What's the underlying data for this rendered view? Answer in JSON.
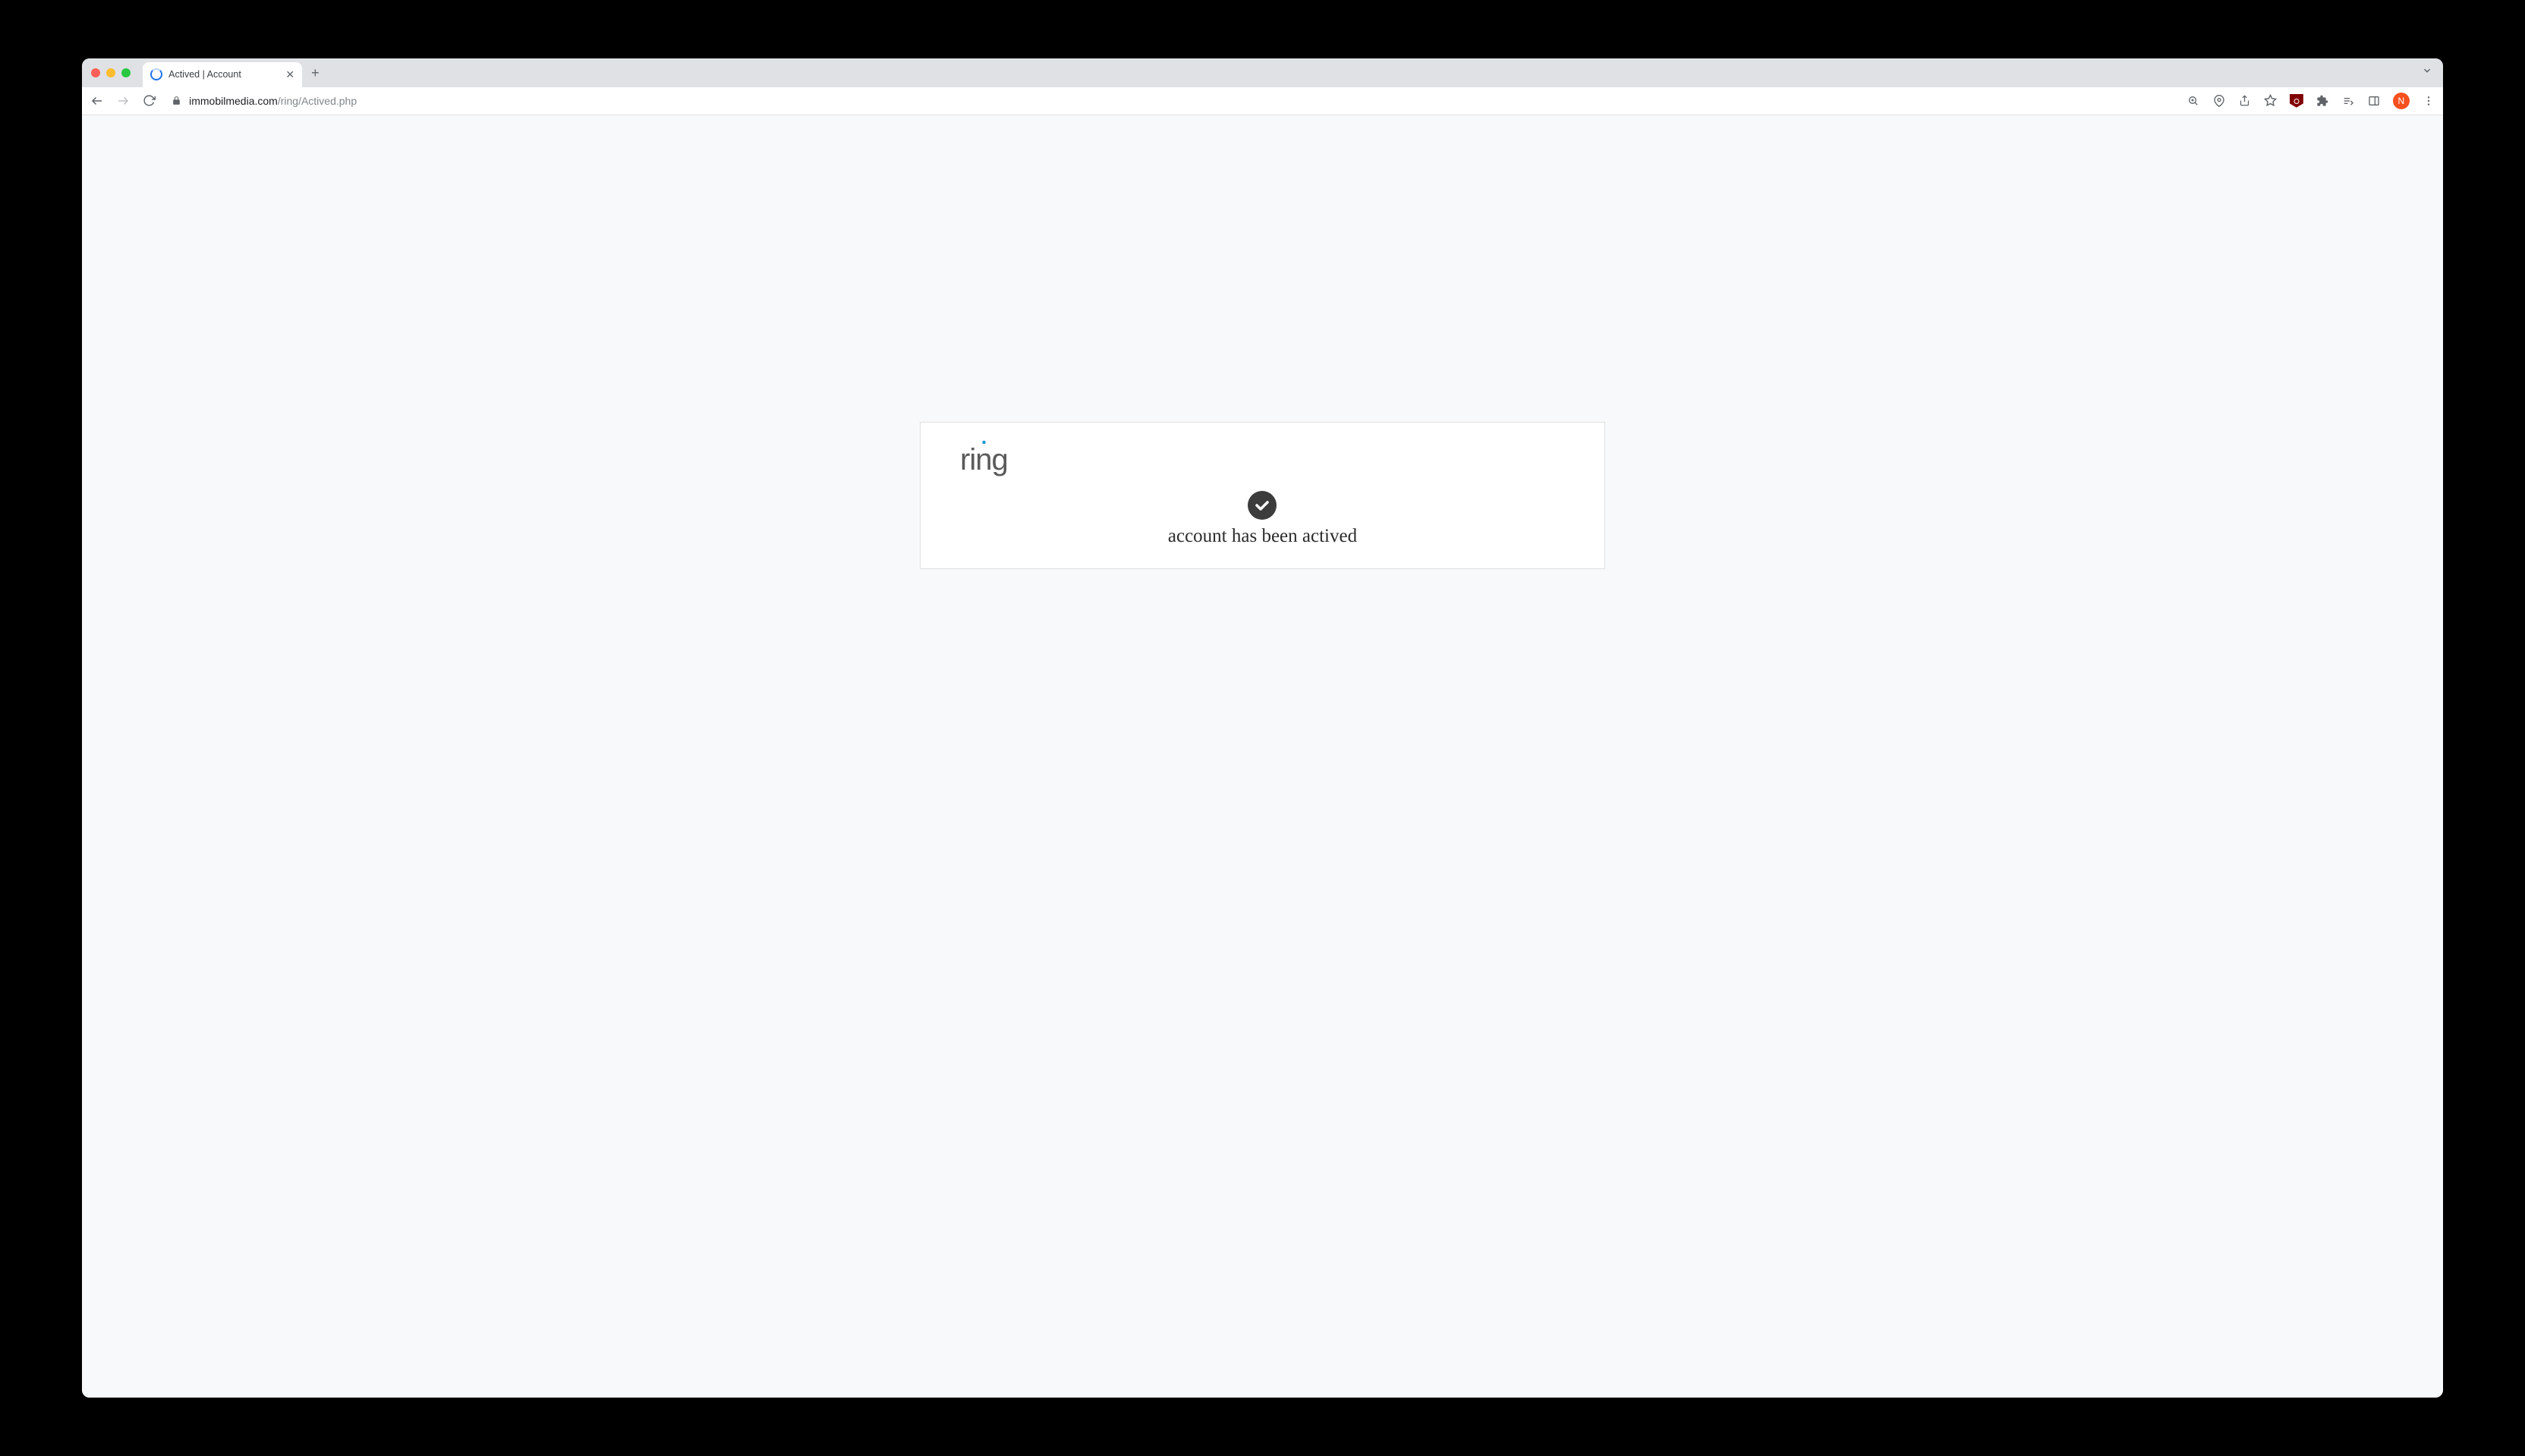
{
  "browser": {
    "tab": {
      "title": "Actived | Account"
    },
    "url": {
      "domain": "immobilmedia.com",
      "path": "/ring/Actived.php"
    },
    "avatar_initial": "N"
  },
  "page": {
    "logo_text": "ring",
    "status_message": "account has been actived"
  }
}
